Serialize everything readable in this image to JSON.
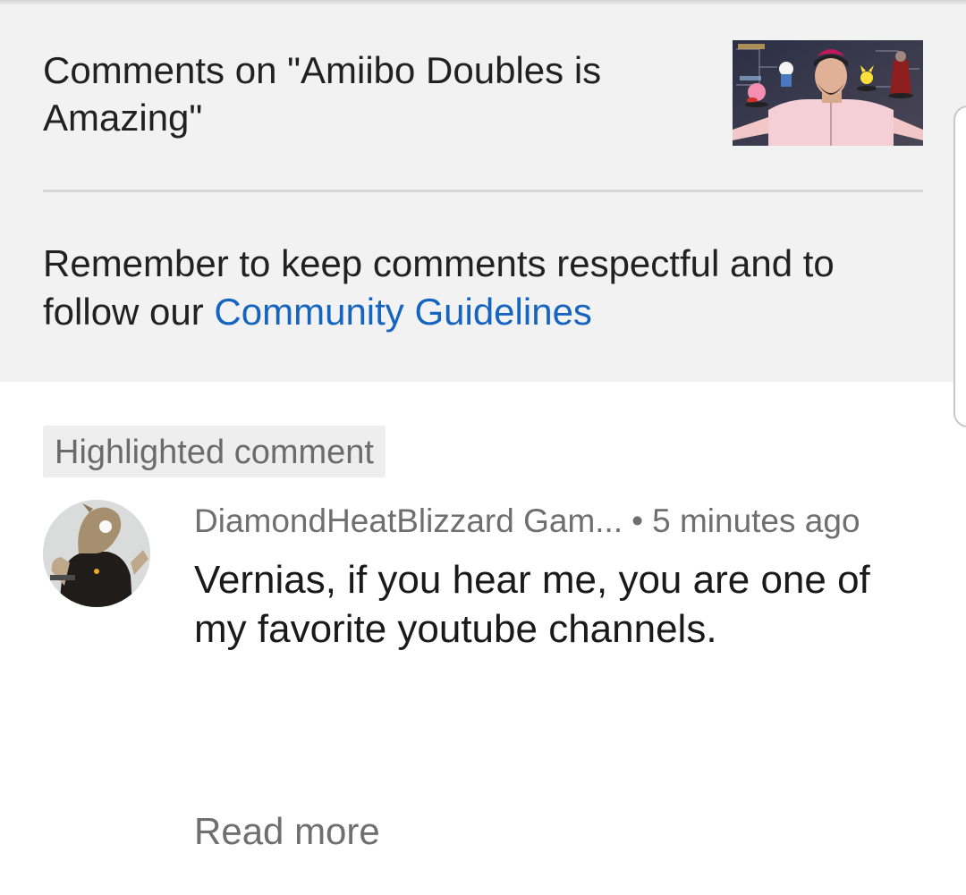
{
  "header": {
    "title": "Comments on \"Amiibo Doubles is Amazing\"",
    "guidelines_prefix": "Remember to keep comments respectful and to follow our ",
    "guidelines_link": "Community Guidelines"
  },
  "highlighted_comment": {
    "badge": "Highlighted comment",
    "author": "DiamondHeatBlizzard Gam...",
    "separator": "•",
    "time": "5 minutes ago",
    "text": "Vernias, if you hear me, you are one of my favorite youtube channels.",
    "read_more": "Read more"
  },
  "colors": {
    "header_bg": "#f2f2f2",
    "link": "#1565c0",
    "secondary_text": "#6f6f6f"
  }
}
